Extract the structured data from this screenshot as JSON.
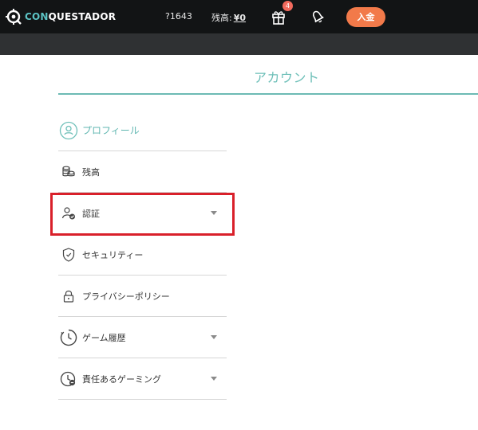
{
  "brand": {
    "prefix": "CON",
    "rest": "QUESTADOR"
  },
  "header": {
    "user_id": "?1643",
    "balance_label": "残高:",
    "balance_amount": "¥0",
    "gift_badge": "4",
    "deposit_label": "入金"
  },
  "page": {
    "title": "アカウント"
  },
  "menu": {
    "items": [
      {
        "label": "プロフィール",
        "icon": "profile-icon"
      },
      {
        "label": "残高",
        "icon": "coins-icon"
      },
      {
        "label": "認証",
        "icon": "user-check-icon"
      },
      {
        "label": "セキュリティー",
        "icon": "shield-icon"
      },
      {
        "label": "プライバシーポリシー",
        "icon": "lock-icon"
      },
      {
        "label": "ゲーム履歴",
        "icon": "clock-icon"
      },
      {
        "label": "責任あるゲーミング",
        "icon": "responsible-gaming-icon"
      }
    ]
  },
  "colors": {
    "accent": "#6dbfb8",
    "deposit": "#f27a4a",
    "highlight": "#d9202a",
    "topbar": "#121415"
  }
}
